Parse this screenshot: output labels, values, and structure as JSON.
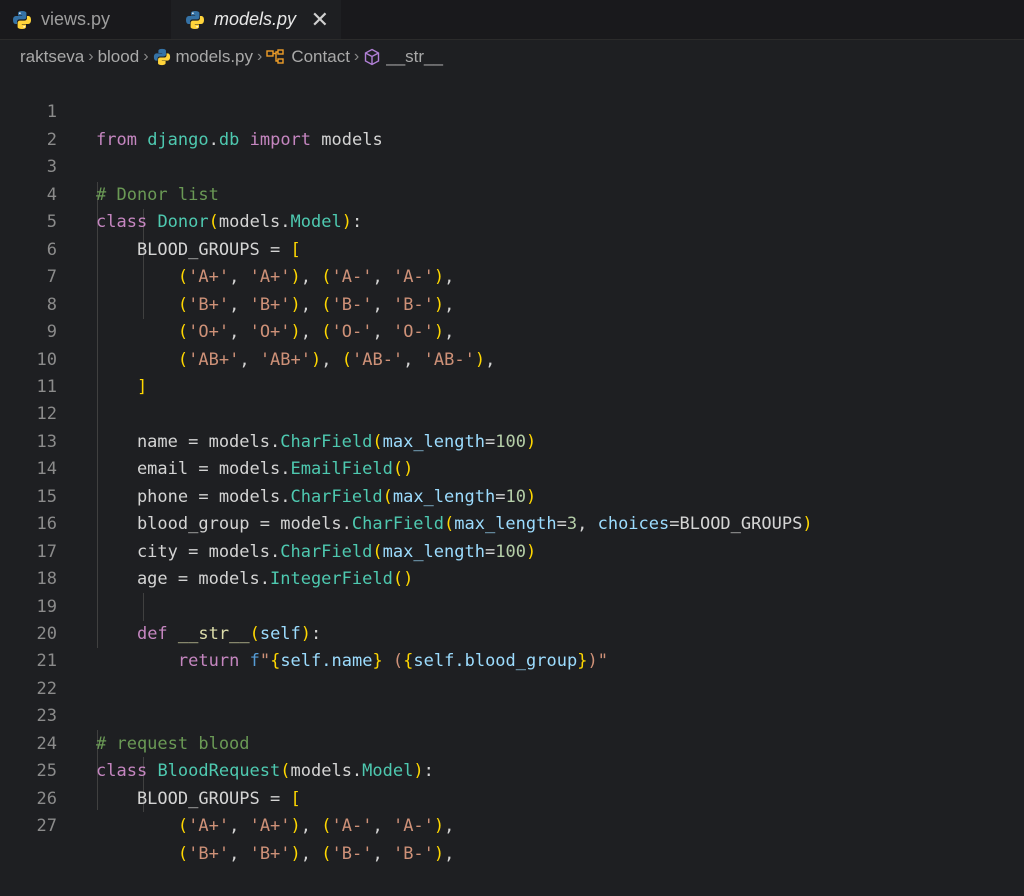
{
  "tabs": [
    {
      "label": "views.py",
      "icon": "python-icon",
      "active": false
    },
    {
      "label": "models.py",
      "icon": "python-icon",
      "active": true,
      "close": "✕"
    }
  ],
  "breadcrumb": {
    "items": [
      {
        "label": "raktseva",
        "icon": null
      },
      {
        "label": "blood",
        "icon": null
      },
      {
        "label": "models.py",
        "icon": "python-icon"
      },
      {
        "label": "Contact",
        "icon": "class-icon"
      },
      {
        "label": "__str__",
        "icon": "method-cube-icon"
      }
    ],
    "separator": "›"
  },
  "lines": [
    {
      "n": "1",
      "text": "from django.db import models"
    },
    {
      "n": "2",
      "text": ""
    },
    {
      "n": "3",
      "text": "# Donor list"
    },
    {
      "n": "4",
      "text": "class Donor(models.Model):"
    },
    {
      "n": "5",
      "text": "    BLOOD_GROUPS = ["
    },
    {
      "n": "6",
      "text": "        ('A+', 'A+'), ('A-', 'A-'),"
    },
    {
      "n": "7",
      "text": "        ('B+', 'B+'), ('B-', 'B-'),"
    },
    {
      "n": "8",
      "text": "        ('O+', 'O+'), ('O-', 'O-'),"
    },
    {
      "n": "9",
      "text": "        ('AB+', 'AB+'), ('AB-', 'AB-'),"
    },
    {
      "n": "10",
      "text": "    ]"
    },
    {
      "n": "11",
      "text": ""
    },
    {
      "n": "12",
      "text": "    name = models.CharField(max_length=100)"
    },
    {
      "n": "13",
      "text": "    email = models.EmailField()"
    },
    {
      "n": "14",
      "text": "    phone = models.CharField(max_length=10)"
    },
    {
      "n": "15",
      "text": "    blood_group = models.CharField(max_length=3, choices=BLOOD_GROUPS)"
    },
    {
      "n": "16",
      "text": "    city = models.CharField(max_length=100)"
    },
    {
      "n": "17",
      "text": "    age = models.IntegerField()"
    },
    {
      "n": "18",
      "text": ""
    },
    {
      "n": "19",
      "text": "    def __str__(self):"
    },
    {
      "n": "20",
      "text": "        return f\"{self.name} ({self.blood_group})\""
    },
    {
      "n": "21",
      "text": ""
    },
    {
      "n": "22",
      "text": ""
    },
    {
      "n": "23",
      "text": "# request blood"
    },
    {
      "n": "24",
      "text": "class BloodRequest(models.Model):"
    },
    {
      "n": "25",
      "text": "    BLOOD_GROUPS = ["
    },
    {
      "n": "26",
      "text": "        ('A+', 'A+'), ('A-', 'A-'),"
    },
    {
      "n": "27",
      "text": "        ('B+', 'B+'), ('B-', 'B-'),"
    }
  ],
  "colors": {
    "background": "#1e1f22",
    "keyword": "#c586c0",
    "class": "#4ec9b0",
    "string": "#ce9178",
    "comment": "#6a9955",
    "parameter": "#9cdcfe",
    "number": "#b5cea8",
    "python_blue": "#3572a5",
    "python_yellow": "#ffd43b"
  }
}
